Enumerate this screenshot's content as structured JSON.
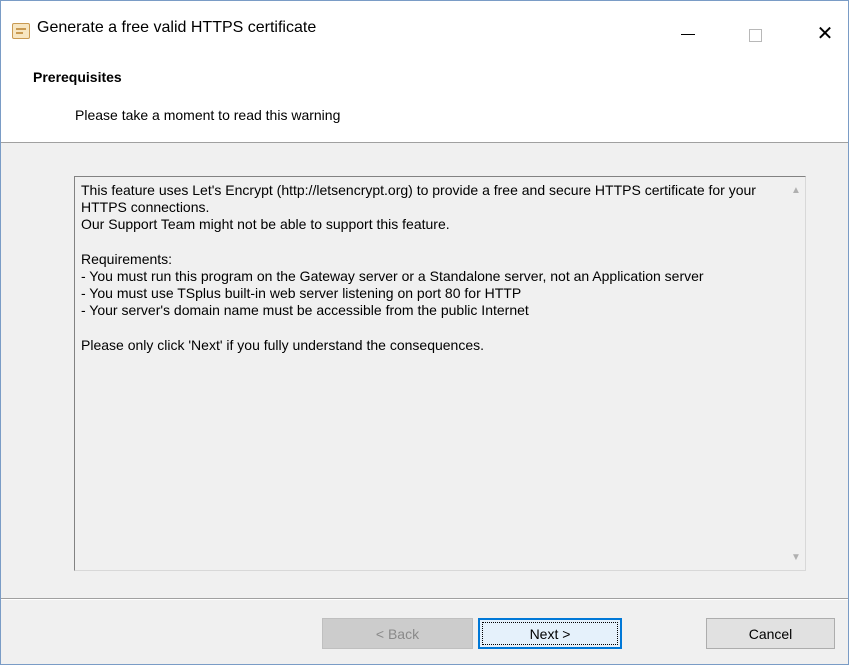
{
  "window": {
    "title": "Generate a free valid HTTPS certificate",
    "icon": "certificate-app-icon",
    "controls": {
      "minimize_icon": "minimize-icon",
      "maximize_icon": "maximize-icon",
      "close_symbol": "✕"
    }
  },
  "header": {
    "title": "Prerequisites",
    "subtitle": "Please take a moment to read this warning"
  },
  "warning": {
    "text": "This feature uses Let's Encrypt (http://letsencrypt.org) to provide a free and secure HTTPS certificate for your HTTPS connections.\nOur Support Team might not be able to support this feature.\n\nRequirements:\n- You must run this program on the Gateway server or a Standalone server, not an Application server\n- You must use TSplus built-in web server listening on port 80 for HTTP\n- Your server's domain name must be accessible from the public Internet\n\nPlease only click 'Next' if you fully understand the consequences."
  },
  "scrollbar": {
    "up_symbol": "▲",
    "down_symbol": "▼"
  },
  "buttons": {
    "back": "< Back",
    "next": "Next >",
    "cancel": "Cancel"
  }
}
